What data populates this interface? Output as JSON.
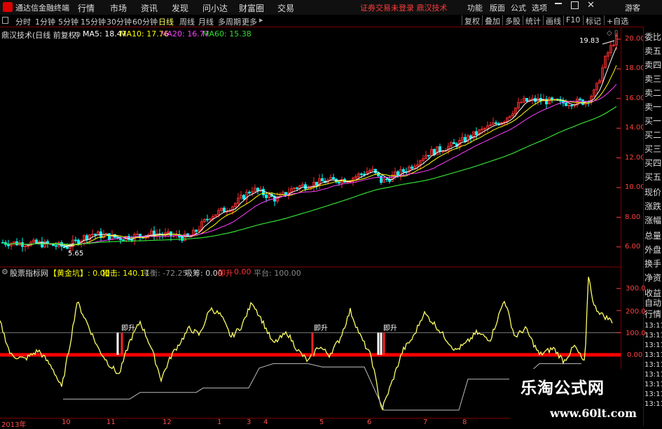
{
  "app": {
    "title": "通达信金融终端",
    "guest": "游客",
    "notice": "证券交易未登录  鼎汉技术"
  },
  "main_menu": [
    "行情",
    "市场",
    "资讯",
    "发现",
    "问小达",
    "财富圈",
    "交易"
  ],
  "right_menu": [
    "功能",
    "版面",
    "公式",
    "选项"
  ],
  "period_tabs": [
    "分时",
    "1分钟",
    "5分钟",
    "15分钟",
    "30分钟",
    "60分钟",
    "日线",
    "周线",
    "月线",
    "多周期",
    "更多"
  ],
  "active_period": "日线",
  "toolbar_buttons": [
    "复权",
    "叠加",
    "多股",
    "统计",
    "画线",
    "F10",
    "标记",
    "+自选"
  ],
  "main_chart": {
    "stock": "鼎汉技术(日线 前复权)",
    "ma": [
      {
        "label": "MA5: 18.47",
        "color": "#ffffff"
      },
      {
        "label": "MA10: 17.76",
        "color": "#ffff00"
      },
      {
        "label": "MA20: 16.77",
        "color": "#ff40ff"
      },
      {
        "label": "MA60: 15.38",
        "color": "#33dd33"
      }
    ],
    "price_ticks": [
      "20.00",
      "18.00",
      "16.00",
      "14.00",
      "12.00",
      "10.00",
      "8.00",
      "6.00"
    ],
    "high_label": "19.83",
    "low_label": "5.65"
  },
  "quote_panel": [
    "委比",
    "卖五",
    "卖四",
    "卖三",
    "卖二",
    "卖一",
    "买一",
    "买二",
    "买三",
    "买四",
    "买五",
    "现价",
    "涨跌",
    "涨幅",
    "总量",
    "外盘",
    "换手",
    "净资",
    "收益",
    "自动",
    "行情",
    "13:11",
    "13:11",
    "13:11",
    "13:11",
    "13:11",
    "13:11",
    "13:11",
    "13:11",
    "13:11"
  ],
  "indicator": {
    "name": "股票指标网",
    "values": [
      {
        "label": "【黄金坑】: 0.00",
        "color": "#ffff00"
      },
      {
        "label": "猎击: 140.11",
        "color": "#ffff00"
      },
      {
        "label": "平衡: -72.25",
        "color": "#888888"
      },
      {
        "label": "吸筹: 0.00",
        "color": "#dddddd"
      },
      {
        "label": "即升",
        "color": "#ff3030"
      },
      {
        "label": "0.00",
        "color": "#ff3030"
      },
      {
        "label": "平台: 100.00",
        "color": "#888888"
      }
    ],
    "ticks": [
      "300.0",
      "200.0",
      "100.0",
      "0.00"
    ],
    "signal_label": "即升"
  },
  "x_axis": [
    "2013年",
    "10",
    "11",
    "12",
    "1",
    "3",
    "4",
    "5",
    "6",
    "7",
    "8"
  ],
  "watermark": {
    "line1": "乐淘公式网",
    "line2": "www.60lt.com"
  },
  "colors": {
    "up": "#ff3030",
    "down": "#00ffff",
    "frame": "#7a0000",
    "ma5": "#ffffff",
    "ma10": "#ffff00",
    "ma20": "#ff40ff",
    "ma60": "#33dd33",
    "osc": "#ffff66"
  }
}
